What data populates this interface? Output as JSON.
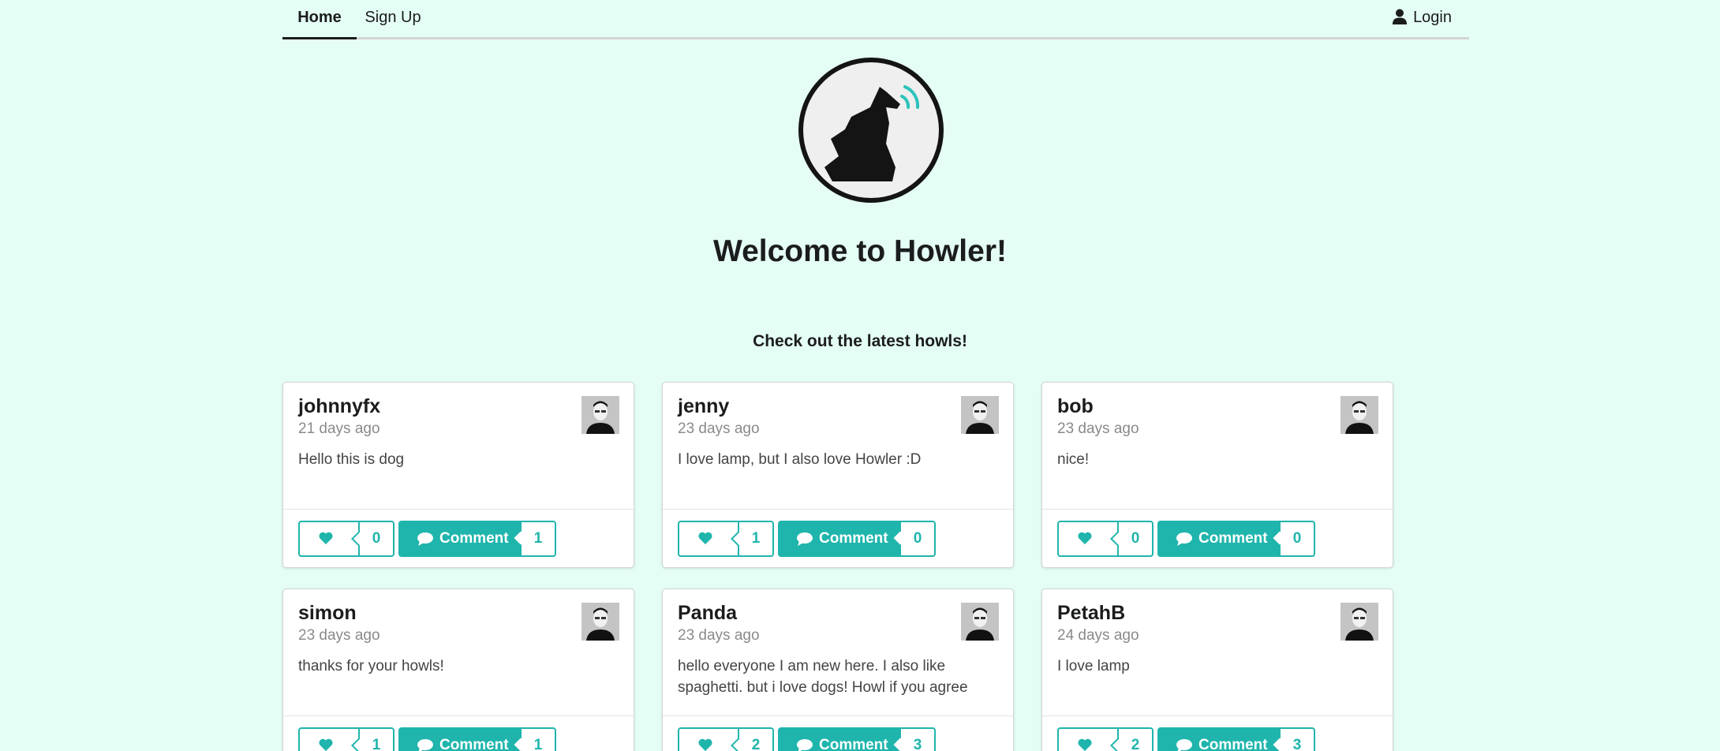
{
  "nav": {
    "home": "Home",
    "signup": "Sign Up",
    "login": "Login"
  },
  "hero": {
    "title": "Welcome to Howler!",
    "subtitle": "Check out the latest howls!"
  },
  "colors": {
    "background": "#e4fdf5",
    "accent": "#1fb5ac"
  },
  "howls": [
    {
      "username": "johnnyfx",
      "time": "21 days ago",
      "text": "Hello this is dog",
      "likes": "0",
      "comment_label": "Comment",
      "comments": "1"
    },
    {
      "username": "jenny",
      "time": "23 days ago",
      "text": "I love lamp, but I also love Howler :D",
      "likes": "1",
      "comment_label": "Comment",
      "comments": "0"
    },
    {
      "username": "bob",
      "time": "23 days ago",
      "text": "nice!",
      "likes": "0",
      "comment_label": "Comment",
      "comments": "0"
    },
    {
      "username": "simon",
      "time": "23 days ago",
      "text": "thanks for your howls!",
      "likes": "1",
      "comment_label": "Comment",
      "comments": "1"
    },
    {
      "username": "Panda",
      "time": "23 days ago",
      "text": "hello everyone I am new here. I also like spaghetti. but i love dogs! Howl if you agree",
      "likes": "2",
      "comment_label": "Comment",
      "comments": "3"
    },
    {
      "username": "PetahB",
      "time": "24 days ago",
      "text": "I love lamp",
      "likes": "2",
      "comment_label": "Comment",
      "comments": "3"
    }
  ]
}
